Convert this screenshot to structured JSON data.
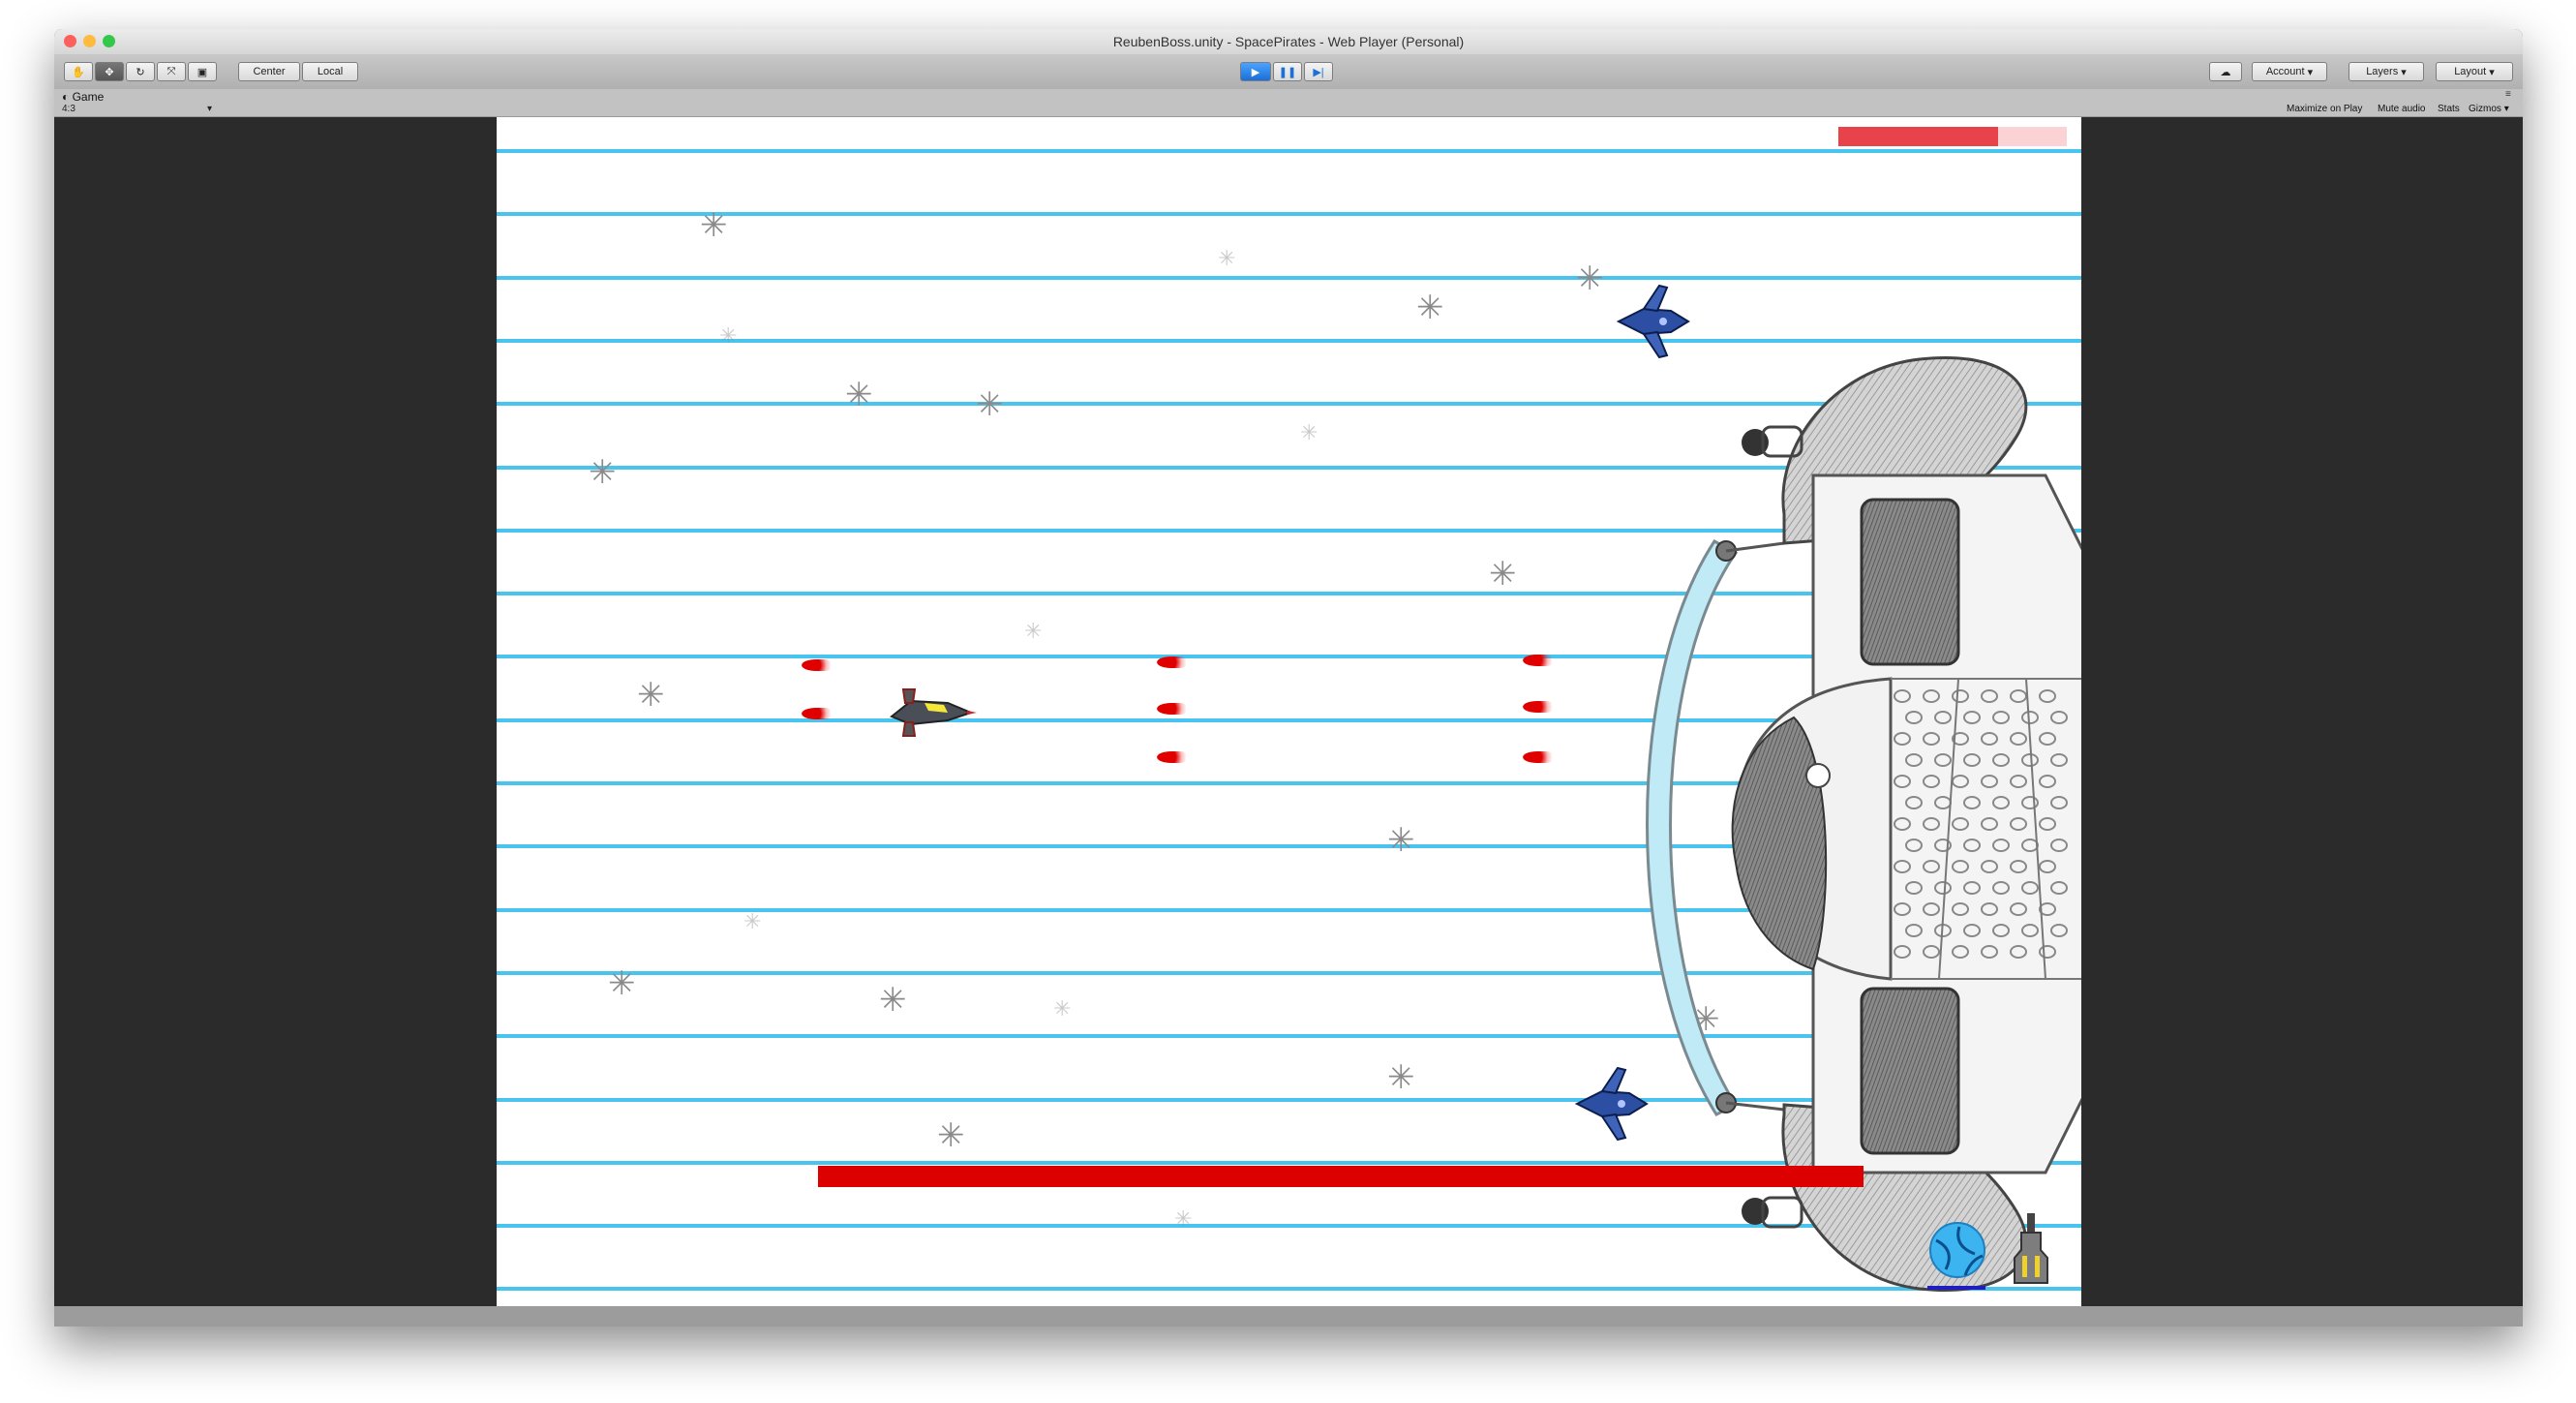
{
  "window": {
    "title": "ReubenBoss.unity - SpacePirates - Web Player (Personal)"
  },
  "toolbar": {
    "pivot_label": "Center",
    "space_label": "Local",
    "account_label": "Account",
    "layers_label": "Layers",
    "layout_label": "Layout"
  },
  "game_tab": {
    "label": "Game",
    "aspect": "4:3",
    "maximize_label": "Maximize on Play",
    "mute_label": "Mute audio",
    "stats_label": "Stats",
    "gizmos_label": "Gizmos"
  },
  "game": {
    "player_health": 1.0,
    "boss_health": 0.7,
    "colors": {
      "lines": "#49c4ee",
      "health": "#dd0000",
      "boss_bar": "#e8434b",
      "shield": "#bfeaf6"
    },
    "hud_icons": [
      "shield-orb-icon",
      "missile-icon"
    ]
  }
}
